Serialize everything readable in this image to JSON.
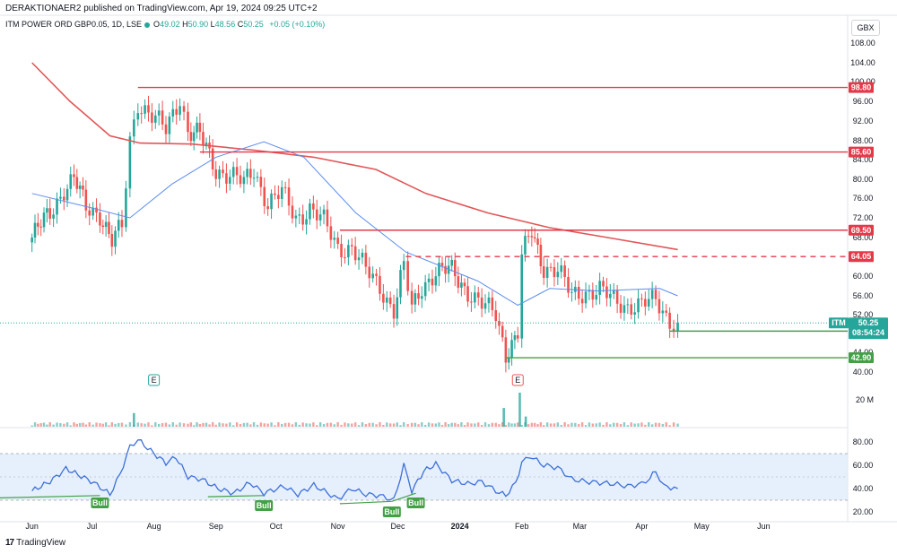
{
  "header": {
    "publish_text": "DERAKTIONAER2 published on TradingView.com, Apr 19, 2024 09:25 UTC+2",
    "symbol": "ITM POWER ORD GBP0.05, 1D, LSE",
    "open_label": "O",
    "open": "49.02",
    "high_label": "H",
    "high": "50.90",
    "low_label": "L",
    "low": "48.56",
    "close_label": "C",
    "close": "50.25",
    "change": "+0.05 (+0.10%)",
    "currency": "GBX"
  },
  "footer": {
    "brand": "TradingView",
    "logo_mark": "17"
  },
  "colors": {
    "up": "#26a69a",
    "down": "#ef5350",
    "resistance": "#e53949",
    "support": "#43a047",
    "sma_slow": "#e25557",
    "sma_fast": "#5b8def",
    "rsi": "#3d6fd8",
    "rsi_band": "#dce9fb"
  },
  "chart_data": [
    {
      "type": "candlestick",
      "title": "ITM POWER ORD GBP0.05, 1D, LSE",
      "currency": "GBX",
      "x_labels": [
        "Jun",
        "Jul",
        "Aug",
        "Sep",
        "Oct",
        "Nov",
        "Dec",
        "2024",
        "Feb",
        "Mar",
        "Apr",
        "May",
        "Jun"
      ],
      "y_ticks": [
        "108.00",
        "104.00",
        "100.00",
        "96.00",
        "92.00",
        "88.00",
        "84.00",
        "80.00",
        "76.00",
        "72.00",
        "68.00",
        "60.00",
        "56.00",
        "52.00",
        "44.00",
        "40.00"
      ],
      "ylim": [
        40,
        110
      ],
      "close_series": [
        [
          "2023-06-01",
          68
        ],
        [
          "2023-06-10",
          73
        ],
        [
          "2023-06-17",
          78
        ],
        [
          "2023-06-22",
          80
        ],
        [
          "2023-06-28",
          74
        ],
        [
          "2023-07-05",
          73
        ],
        [
          "2023-07-11",
          67
        ],
        [
          "2023-07-16",
          70
        ],
        [
          "2023-07-20",
          88
        ],
        [
          "2023-07-24",
          96
        ],
        [
          "2023-07-31",
          93
        ],
        [
          "2023-08-07",
          90
        ],
        [
          "2023-08-14",
          97
        ],
        [
          "2023-08-18",
          90
        ],
        [
          "2023-08-24",
          89
        ],
        [
          "2023-09-01",
          82
        ],
        [
          "2023-09-08",
          81
        ],
        [
          "2023-09-15",
          79
        ],
        [
          "2023-09-20",
          82
        ],
        [
          "2023-09-27",
          75
        ],
        [
          "2023-10-04",
          77
        ],
        [
          "2023-10-11",
          72
        ],
        [
          "2023-10-18",
          74
        ],
        [
          "2023-10-25",
          71
        ],
        [
          "2023-11-01",
          66
        ],
        [
          "2023-11-08",
          66
        ],
        [
          "2023-11-15",
          61
        ],
        [
          "2023-11-22",
          58
        ],
        [
          "2023-11-29",
          53
        ],
        [
          "2023-12-04",
          62
        ],
        [
          "2023-12-08",
          53
        ],
        [
          "2023-12-13",
          58
        ],
        [
          "2023-12-20",
          61
        ],
        [
          "2023-12-28",
          61
        ],
        [
          "2024-01-05",
          57
        ],
        [
          "2024-01-12",
          54
        ],
        [
          "2024-01-19",
          52
        ],
        [
          "2024-01-24",
          44
        ],
        [
          "2024-01-30",
          48
        ],
        [
          "2024-02-01",
          64
        ],
        [
          "2024-02-06",
          69
        ],
        [
          "2024-02-12",
          62
        ],
        [
          "2024-02-19",
          61
        ],
        [
          "2024-02-26",
          56
        ],
        [
          "2024-03-04",
          57
        ],
        [
          "2024-03-11",
          57
        ],
        [
          "2024-03-18",
          55
        ],
        [
          "2024-03-25",
          54
        ],
        [
          "2024-04-01",
          54
        ],
        [
          "2024-04-08",
          55
        ],
        [
          "2024-04-15",
          51
        ],
        [
          "2024-04-19",
          50.25
        ]
      ],
      "sma_slow": [
        [
          "2023-06-01",
          104
        ],
        [
          "2023-06-20",
          96
        ],
        [
          "2023-07-10",
          89
        ],
        [
          "2023-07-25",
          87.5
        ],
        [
          "2023-08-20",
          87.3
        ],
        [
          "2023-09-20",
          86
        ],
        [
          "2023-10-20",
          84.5
        ],
        [
          "2023-11-20",
          82
        ],
        [
          "2023-12-15",
          77
        ],
        [
          "2024-01-15",
          73
        ],
        [
          "2024-02-15",
          70
        ],
        [
          "2024-03-15",
          68
        ],
        [
          "2024-04-19",
          65.5
        ]
      ],
      "sma_fast": [
        [
          "2023-06-01",
          77
        ],
        [
          "2023-07-01",
          74
        ],
        [
          "2023-07-20",
          72
        ],
        [
          "2023-08-10",
          79
        ],
        [
          "2023-09-01",
          84.5
        ],
        [
          "2023-09-25",
          87.8
        ],
        [
          "2023-10-15",
          84.5
        ],
        [
          "2023-11-10",
          73
        ],
        [
          "2023-12-05",
          65
        ],
        [
          "2024-01-10",
          59
        ],
        [
          "2024-01-30",
          54
        ],
        [
          "2024-02-15",
          57.5
        ],
        [
          "2024-03-10",
          57
        ],
        [
          "2024-04-10",
          57.5
        ],
        [
          "2024-04-19",
          56
        ]
      ],
      "levels": [
        {
          "label": "98.80",
          "value": 98.8,
          "style": "solid",
          "color": "#e53949",
          "from": "2023-07-24"
        },
        {
          "label": "85.60",
          "value": 85.6,
          "style": "solid",
          "color": "#e53949",
          "from": "2023-08-24"
        },
        {
          "label": "69.50",
          "value": 69.5,
          "style": "solid",
          "color": "#e53949",
          "from": "2023-11-02"
        },
        {
          "label": "64.05",
          "value": 64.05,
          "style": "dashed",
          "color": "#e53949",
          "from": "2023-12-05"
        },
        {
          "label": "48.50",
          "value": 48.5,
          "style": "solid",
          "color": "#43a047",
          "from": "2024-04-15"
        },
        {
          "label": "42.90",
          "value": 42.9,
          "style": "solid",
          "color": "#43a047",
          "from": "2024-01-24"
        }
      ],
      "last_price": {
        "symbol": "ITM",
        "value": "50.25",
        "countdown": "08:54:24"
      },
      "earnings_markers": [
        {
          "date": "2023-08-01",
          "label": "E"
        },
        {
          "date": "2024-01-30",
          "label": "E"
        }
      ]
    },
    {
      "type": "bar",
      "title": "Volume",
      "y_ticks": [
        "20 M"
      ],
      "spikes": [
        [
          "2023-07-22",
          0.4
        ],
        [
          "2024-01-23",
          0.55
        ],
        [
          "2024-01-31",
          1.0
        ],
        [
          "2024-02-03",
          0.3
        ]
      ]
    },
    {
      "type": "line",
      "title": "RSI",
      "y_ticks": [
        "80.00",
        "60.00",
        "40.00",
        "20.00"
      ],
      "ylim": [
        20,
        85
      ],
      "band": [
        30,
        70
      ],
      "values": [
        [
          "2023-06-01",
          38
        ],
        [
          "2023-06-10",
          46
        ],
        [
          "2023-06-18",
          57
        ],
        [
          "2023-06-24",
          52
        ],
        [
          "2023-07-02",
          45
        ],
        [
          "2023-07-10",
          35
        ],
        [
          "2023-07-15",
          52
        ],
        [
          "2023-07-20",
          76
        ],
        [
          "2023-07-24",
          82
        ],
        [
          "2023-08-01",
          70
        ],
        [
          "2023-08-07",
          62
        ],
        [
          "2023-08-12",
          67
        ],
        [
          "2023-08-18",
          50
        ],
        [
          "2023-08-25",
          48
        ],
        [
          "2023-09-02",
          40
        ],
        [
          "2023-09-10",
          36
        ],
        [
          "2023-09-18",
          45
        ],
        [
          "2023-09-25",
          36
        ],
        [
          "2023-10-05",
          42
        ],
        [
          "2023-10-12",
          35
        ],
        [
          "2023-10-20",
          43
        ],
        [
          "2023-11-01",
          31
        ],
        [
          "2023-11-08",
          40
        ],
        [
          "2023-11-15",
          35
        ],
        [
          "2023-11-22",
          34
        ],
        [
          "2023-11-29",
          30
        ],
        [
          "2023-12-04",
          60
        ],
        [
          "2023-12-08",
          38
        ],
        [
          "2023-12-14",
          55
        ],
        [
          "2023-12-20",
          61
        ],
        [
          "2023-12-28",
          47
        ],
        [
          "2024-01-05",
          44
        ],
        [
          "2024-01-12",
          46
        ],
        [
          "2024-01-19",
          38
        ],
        [
          "2024-01-24",
          34
        ],
        [
          "2024-01-29",
          45
        ],
        [
          "2024-02-01",
          62
        ],
        [
          "2024-02-05",
          68
        ],
        [
          "2024-02-12",
          60
        ],
        [
          "2024-02-19",
          58
        ],
        [
          "2024-02-26",
          48
        ],
        [
          "2024-03-04",
          46
        ],
        [
          "2024-03-11",
          45
        ],
        [
          "2024-03-18",
          44
        ],
        [
          "2024-03-25",
          42
        ],
        [
          "2024-04-01",
          44
        ],
        [
          "2024-04-05",
          49
        ],
        [
          "2024-04-08",
          55
        ],
        [
          "2024-04-12",
          42
        ],
        [
          "2024-04-19",
          40
        ]
      ],
      "bull_labels": [
        {
          "date": "2023-07-05",
          "label": "Bull"
        },
        {
          "date": "2023-09-25",
          "label": "Bull"
        },
        {
          "date": "2023-11-28",
          "label": "Bull"
        },
        {
          "date": "2023-12-10",
          "label": "Bull"
        }
      ]
    }
  ]
}
